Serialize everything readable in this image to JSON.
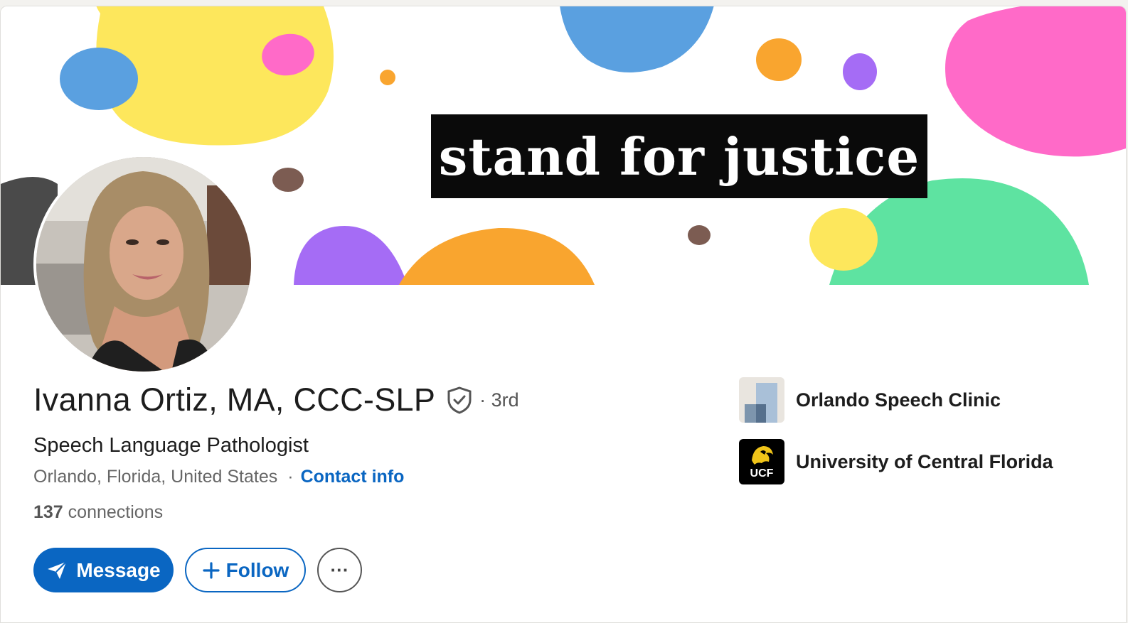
{
  "banner": {
    "slogan": "stand for justice"
  },
  "profile": {
    "name": "Ivanna Ortiz, MA, CCC-SLP",
    "degree": "· 3rd",
    "headline": "Speech Language Pathologist",
    "location": "Orlando, Florida, United States",
    "separator": "·",
    "contact_label": "Contact info",
    "connections_count": "137",
    "connections_label": "connections"
  },
  "actions": {
    "message_label": "Message",
    "follow_label": "Follow",
    "more_label": "···"
  },
  "orgs": [
    {
      "name": "Orlando Speech Clinic",
      "icon": "company-placeholder-logo"
    },
    {
      "name": "University of Central Florida",
      "icon": "ucf-logo",
      "logo_text": "UCF"
    }
  ],
  "colors": {
    "accent": "#0a66c2",
    "text": "#1d1d1d",
    "muted": "#666666"
  }
}
